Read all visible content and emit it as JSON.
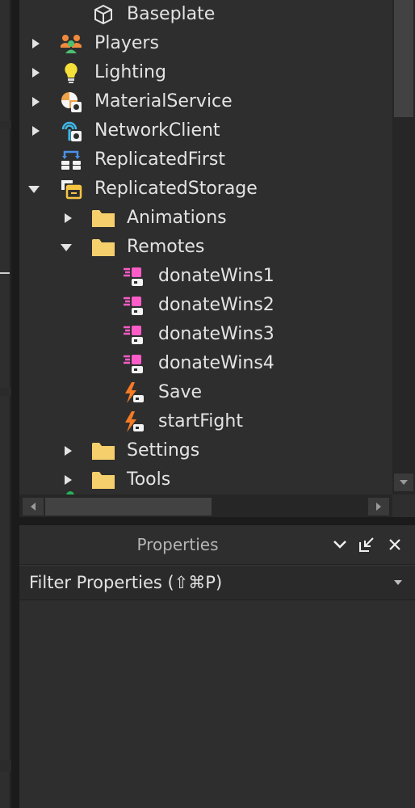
{
  "explorer": {
    "items": [
      {
        "label": "Baseplate",
        "icon": "cube-icon",
        "expander": "none"
      },
      {
        "label": "Players",
        "icon": "players-icon",
        "expander": "collapsed"
      },
      {
        "label": "Lighting",
        "icon": "lightbulb-icon",
        "expander": "collapsed"
      },
      {
        "label": "MaterialService",
        "icon": "material-service-icon",
        "expander": "collapsed"
      },
      {
        "label": "NetworkClient",
        "icon": "network-client-icon",
        "expander": "collapsed"
      },
      {
        "label": "ReplicatedFirst",
        "icon": "replicated-first-icon",
        "expander": "none"
      },
      {
        "label": "ReplicatedStorage",
        "icon": "replicated-storage-icon",
        "expander": "expanded"
      },
      {
        "label": "Animations",
        "icon": "folder-icon",
        "expander": "collapsed"
      },
      {
        "label": "Remotes",
        "icon": "folder-icon",
        "expander": "expanded"
      },
      {
        "label": "donateWins1",
        "icon": "remote-function-icon",
        "expander": "none"
      },
      {
        "label": "donateWins2",
        "icon": "remote-function-icon",
        "expander": "none"
      },
      {
        "label": "donateWins3",
        "icon": "remote-function-icon",
        "expander": "none"
      },
      {
        "label": "donateWins4",
        "icon": "remote-function-icon",
        "expander": "none"
      },
      {
        "label": "Save",
        "icon": "remote-event-icon",
        "expander": "none"
      },
      {
        "label": "startFight",
        "icon": "remote-event-icon",
        "expander": "none"
      },
      {
        "label": "Settings",
        "icon": "folder-icon",
        "expander": "collapsed"
      },
      {
        "label": "Tools",
        "icon": "folder-icon",
        "expander": "collapsed"
      }
    ]
  },
  "properties": {
    "title": "Properties",
    "filter_placeholder": "Filter Properties (⇧⌘P)"
  },
  "colors": {
    "panel_bg": "#2e2e2e",
    "text": "#e3e3e3",
    "folder": "#f5cf6b",
    "remote_function": "#ff5cc8",
    "remote_event": "#f47a25"
  }
}
